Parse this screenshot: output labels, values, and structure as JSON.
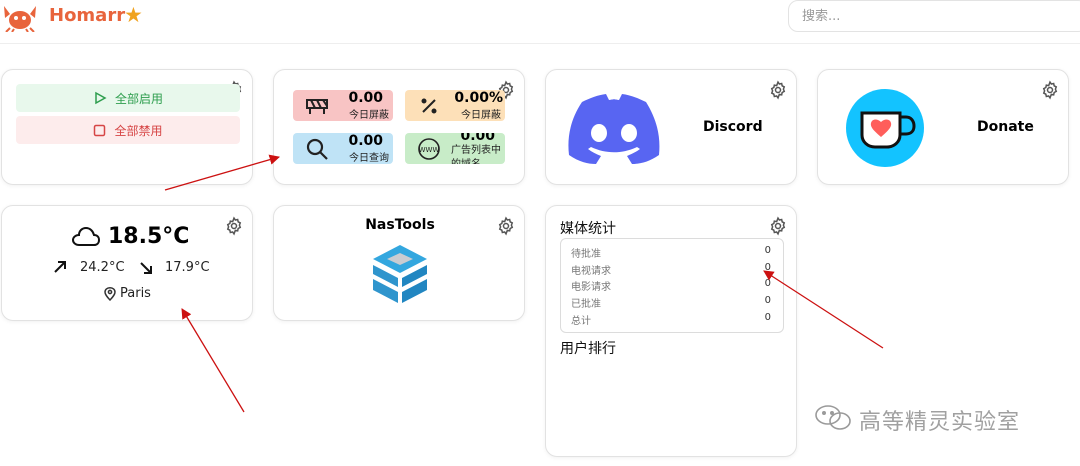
{
  "header": {
    "brand": "Homarr",
    "star_icon": "star-icon",
    "search_placeholder": "搜索..."
  },
  "control": {
    "enable_all": "全部启用",
    "disable_all": "全部禁用"
  },
  "adguard": {
    "stats": [
      {
        "value": "0.00",
        "label": "今日屏蔽",
        "icon": "barrier-icon",
        "color": "#f8c4c4"
      },
      {
        "value": "0.00%",
        "label": "今日屏蔽",
        "icon": "percent-icon",
        "color": "#fde0b8"
      },
      {
        "value": "0.00",
        "label": "今日查询",
        "icon": "search-icon",
        "color": "#bfe3f6"
      },
      {
        "value": "0.00",
        "label": "广告列表中的域名",
        "icon": "www-icon",
        "color": "#c8ecc8"
      }
    ]
  },
  "discord": {
    "label": "Discord"
  },
  "donate": {
    "label": "Donate"
  },
  "weather": {
    "temperature": "18.5°C",
    "high": "24.2°C",
    "low": "17.9°C",
    "location": "Paris"
  },
  "nastools": {
    "title": "NasTools"
  },
  "media": {
    "title": "媒体统计",
    "rows": [
      {
        "label": "待批准",
        "value": "0"
      },
      {
        "label": "电视请求",
        "value": "0"
      },
      {
        "label": "电影请求",
        "value": "0"
      },
      {
        "label": "已批准",
        "value": "0"
      },
      {
        "label": "总计",
        "value": "0"
      }
    ],
    "ranking_title": "用户排行"
  },
  "watermark": {
    "text": "高等精灵实验室"
  },
  "colors": {
    "brand": "#e8643c",
    "discord": "#5865f2",
    "kofi": "#13c3ff",
    "annotation_arrow": "#cc1111"
  }
}
